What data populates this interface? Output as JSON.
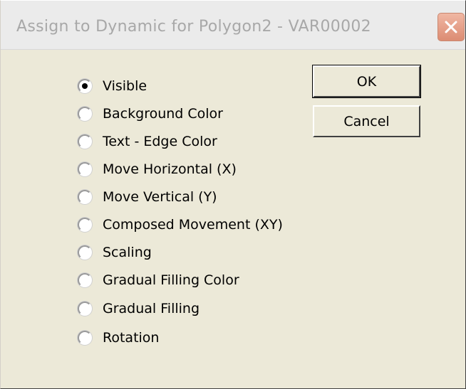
{
  "window": {
    "title": "Assign to Dynamic for Polygon2 - VAR00002"
  },
  "options": [
    {
      "label": "Visible",
      "selected": true
    },
    {
      "label": "Background Color",
      "selected": false
    },
    {
      "label": "Text - Edge Color",
      "selected": false
    },
    {
      "label": "Move Horizontal (X)",
      "selected": false
    },
    {
      "label": "Move Vertical (Y)",
      "selected": false
    },
    {
      "label": "Composed Movement (XY)",
      "selected": false
    },
    {
      "label": "Scaling",
      "selected": false
    },
    {
      "label": "Gradual Filling Color",
      "selected": false
    },
    {
      "label": "Gradual Filling",
      "selected": false
    },
    {
      "label": "Rotation",
      "selected": false
    }
  ],
  "buttons": {
    "ok_label": "OK",
    "cancel_label": "Cancel"
  }
}
